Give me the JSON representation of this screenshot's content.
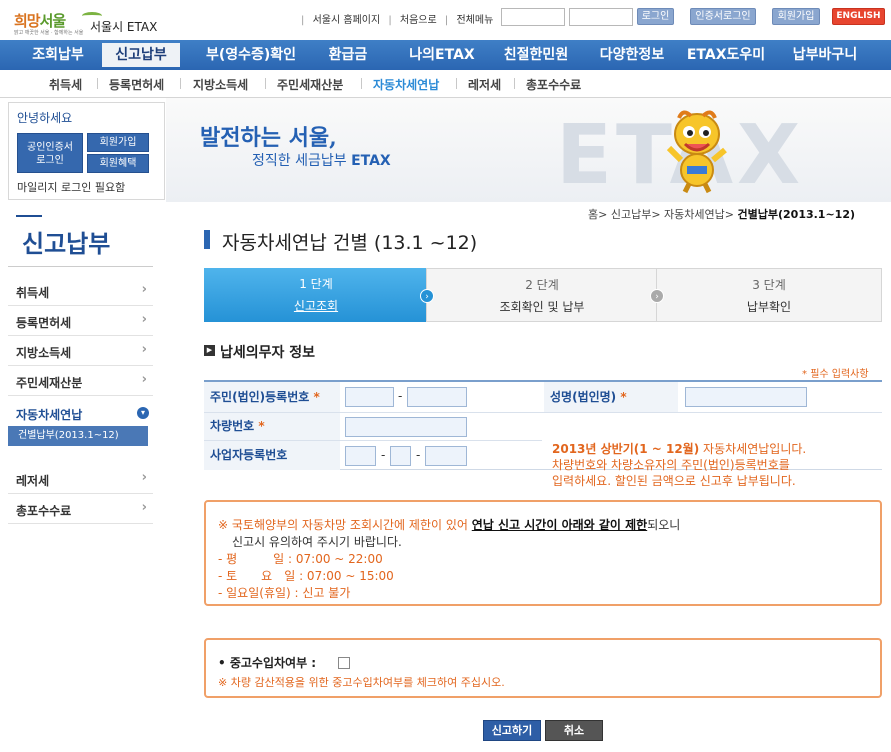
{
  "logo": {
    "mark_a": "희망",
    "mark_b": "서울",
    "tagline": "맑고 깨끗한 서울 · 함께하는 서울",
    "etax": "서울시 ETAX"
  },
  "toplinks": [
    "서울시 홈페이지",
    "처음으로",
    "전체메뉴"
  ],
  "topbuttons": {
    "login": "로그인",
    "cert_login": "인증서로그인",
    "join": "회원가입",
    "english": "ENGLISH"
  },
  "mainnav": [
    "조회납부",
    "신고납부",
    "부(영수증)확인",
    "환급금",
    "나의ETAX",
    "친절한민원",
    "다양한정보",
    "ETAX도우미",
    "납부바구니"
  ],
  "subnav": [
    "취득세",
    "등록면허세",
    "지방소득세",
    "주민세재산분",
    "자동차세연납",
    "레저세",
    "총포수수료"
  ],
  "login_box": {
    "greeting": "안녕하세요",
    "cert_line1": "공인인증서",
    "cert_line2": "로그인",
    "join": "회원가입",
    "benefit": "회원혜택",
    "mileage": "마일리지 로그인 필요함"
  },
  "banner": {
    "line1": "발전하는 서울,",
    "line2_a": "정직한 세금납부 ",
    "line2_b": "ETAX",
    "big": "ETAX"
  },
  "sidebar": {
    "title": "신고납부",
    "items": [
      "취득세",
      "등록면허세",
      "지방소득세",
      "주민세재산분",
      "자동차세연납",
      "레저세",
      "총포수수료"
    ],
    "sub_active": "건별납부(2013.1~12)"
  },
  "breadcrumb": {
    "home": "홈",
    "l1": "신고납부",
    "l2": "자동차세연납",
    "current": "건별납부(2013.1~12)"
  },
  "page_title": "자동차세연납 건별 (13.1 ~12)",
  "steps": [
    {
      "num": "1 단계",
      "label": "신고조회"
    },
    {
      "num": "2 단계",
      "label": "조회확인 및 납부"
    },
    {
      "num": "3 단계",
      "label": "납부확인"
    }
  ],
  "section_title": "납세의무자 정보",
  "required_note": "필수 입력사항",
  "form": {
    "resident_no": "주민(법인)등록번호",
    "name": "성명(법인명)",
    "vehicle_no": "차량번호",
    "business_no": "사업자등록번호",
    "req_mark": "*",
    "notice_a": "2013년 상반기(1 ~ 12월)",
    "notice_b": " 자동차세연납입니다.",
    "notice_c": "차량번호와 차량소유자의 주민(법인)등록번호를",
    "notice_d": "입력하세요. 할인된 금액으로 신고후 납부됩니다."
  },
  "info": {
    "l1_a": "※ 국토해양부의 자동차망 조회시간에 제한이 있어 ",
    "l1_b": "연납 신고 시간이 아래와 같이 제한",
    "l1_c": "되오니",
    "l2": "신고시 유의하여 주시기 바랍니다.",
    "l3": "- 평　　　일 : 07:00 ~ 22:00",
    "l4": "- 토　　요　일 : 07:00 ~ 15:00",
    "l5": "- 일요일(휴일) : 신고 불가"
  },
  "used": {
    "label": "• 중고수입차여부 :",
    "note": "※ 차량 감산적용을 위한 중고수입차여부를 체크하여 주십시오."
  },
  "buttons": {
    "submit": "신고하기",
    "cancel": "취소"
  },
  "colors": {
    "primary": "#2b66b2",
    "accent": "#e2661e",
    "step_active": "#2592d6"
  }
}
